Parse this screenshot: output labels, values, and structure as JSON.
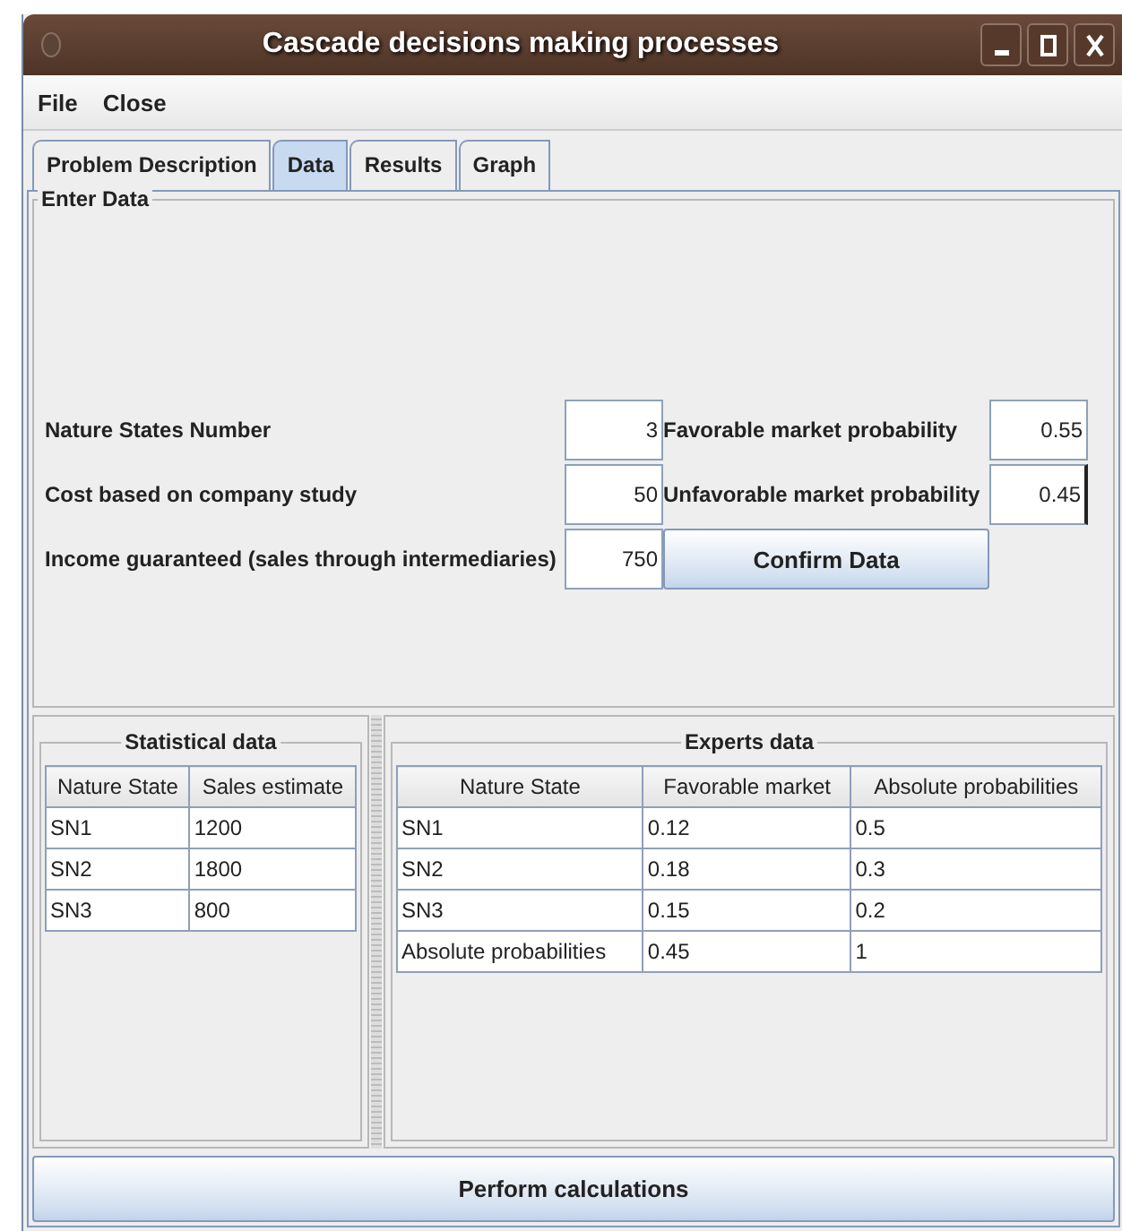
{
  "window": {
    "title": "Cascade decisions making processes"
  },
  "menu": [
    "File",
    "Close"
  ],
  "tabs": [
    {
      "label": "Problem Description",
      "selected": false
    },
    {
      "label": "Data",
      "selected": true
    },
    {
      "label": "Results",
      "selected": false
    },
    {
      "label": "Graph",
      "selected": false
    }
  ],
  "enter_data": {
    "title": "Enter Data",
    "left_fields": [
      {
        "label": "Nature States Number",
        "value": "3",
        "focused": false
      },
      {
        "label": "Cost based on company study",
        "value": "50",
        "focused": false
      },
      {
        "label": "Income guaranteed (sales through intermediaries)",
        "value": "750",
        "focused": false
      }
    ],
    "right_fields": [
      {
        "label": "Favorable market probability",
        "value": "0.55",
        "focused": false
      },
      {
        "label": "Unfavorable market probability",
        "value": "0.45",
        "focused": true
      }
    ],
    "confirm_button": "Confirm Data"
  },
  "statistical_data": {
    "title": "Statistical data",
    "columns": [
      "Nature State",
      "Sales estimate"
    ],
    "rows": [
      [
        "SN1",
        "1200"
      ],
      [
        "SN2",
        "1800"
      ],
      [
        "SN3",
        "800"
      ]
    ]
  },
  "experts_data": {
    "title": "Experts data",
    "columns": [
      "Nature State",
      "Favorable market",
      "Absolute probabilities"
    ],
    "rows": [
      [
        "SN1",
        "0.12",
        "0.5"
      ],
      [
        "SN2",
        "0.18",
        "0.3"
      ],
      [
        "SN3",
        "0.15",
        "0.2"
      ],
      [
        "Absolute probabilities",
        "0.45",
        "1"
      ]
    ]
  },
  "perform_button": "Perform calculations"
}
